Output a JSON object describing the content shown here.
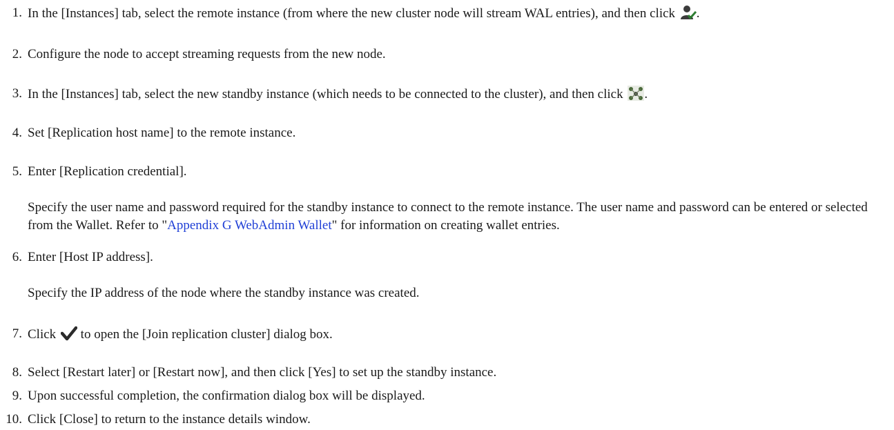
{
  "steps": [
    {
      "num": "1.",
      "text_before": "In the [Instances] tab, select the remote instance (from where the new cluster node will stream WAL entries), and then click",
      "icon": "user-check-icon",
      "text_after": "."
    },
    {
      "num": "2.",
      "text": "Configure the node to accept streaming requests from the new node."
    },
    {
      "num": "3.",
      "text_before": "In the [Instances] tab, select the new standby instance (which needs to be connected to the cluster), and then click",
      "icon": "cluster-join-icon",
      "text_after": "."
    },
    {
      "num": "4.",
      "text": "Set [Replication host name] to the remote instance."
    },
    {
      "num": "5.",
      "text": "Enter [Replication credential].",
      "sub_before": "Specify the user name and password required for the standby instance to connect to the remote instance. The user name and password can be entered or selected from the Wallet. Refer to \"",
      "sub_link": "Appendix G WebAdmin Wallet",
      "sub_after": "\" for information on creating wallet entries."
    },
    {
      "num": "6.",
      "text": "Enter [Host IP address].",
      "sub": "Specify the IP address of the node where the standby instance was created."
    },
    {
      "num": "7.",
      "text_before": "Click",
      "icon": "checkmark-icon",
      "text_after": "to open the [Join replication cluster] dialog box."
    },
    {
      "num": "8.",
      "text": "Select [Restart later] or [Restart now], and then click [Yes] to set up the standby instance."
    },
    {
      "num": "9.",
      "text": "Upon successful completion, the confirmation dialog box will be displayed."
    },
    {
      "num": "10.",
      "text": "Click [Close] to return to the instance details window."
    }
  ],
  "colors": {
    "text": "#1a1a1a",
    "link": "#1f3fd6"
  }
}
